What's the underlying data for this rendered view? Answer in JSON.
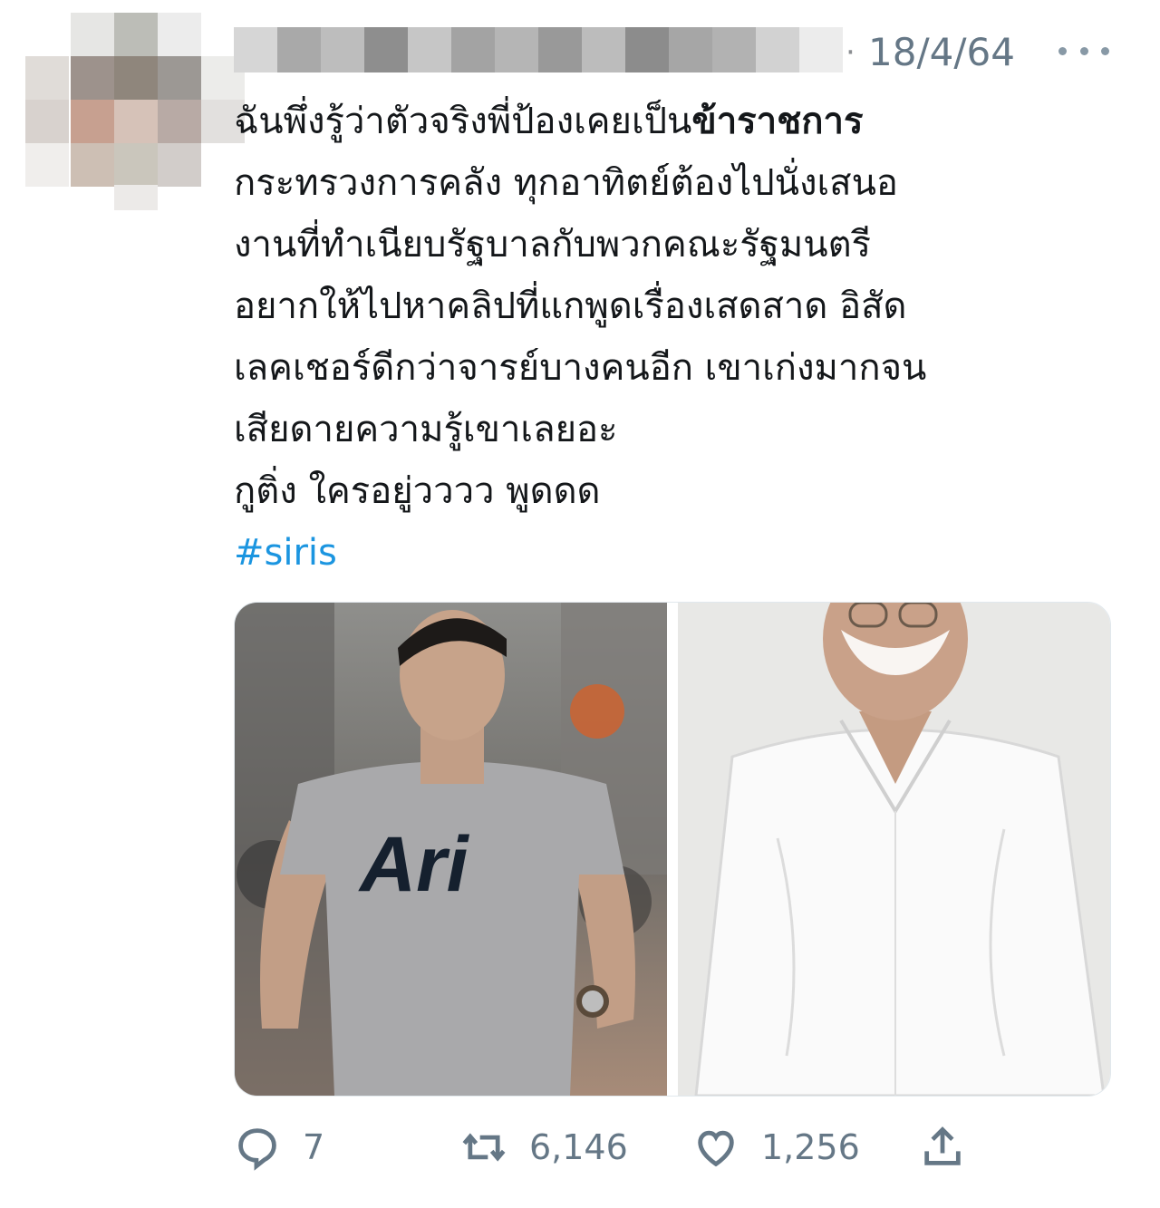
{
  "tweet": {
    "timestamp": "18/4/64",
    "text_lines": [
      {
        "pre": "ฉันพึ่งรู้ว่าตัวจริงพี่ป้องเคยเป็น",
        "bold": "ข้าราชการ"
      },
      "กระทรวงการคลัง ทุกอาทิตย์ต้องไปนั่งเสนอ",
      "งานที่ทำเนียบรัฐบาลกับพวกคณะรัฐมนตรี",
      "อยากให้ไปหาคลิปที่แกพูดเรื่องเสดสาด อิสัด",
      "เลคเชอร์ดีกว่าจารย์บางคนอีก เขาเก่งมากจน",
      "เสียดายความรู้เขาเลยอะ",
      "กูติ่ง ใครอยู่วววว พูดดด"
    ],
    "hashtag": "#siris",
    "shirt_logo": "Ari"
  },
  "actions": {
    "reply": {
      "icon": "reply-icon",
      "count": "7"
    },
    "retweet": {
      "icon": "retweet-icon",
      "count": "6,146"
    },
    "like": {
      "icon": "heart-icon",
      "count": "1,256"
    },
    "share": {
      "icon": "share-icon",
      "count": ""
    }
  },
  "colors": {
    "hashtag": "#1b95e0",
    "muted": "#657786",
    "text": "#14171a"
  }
}
